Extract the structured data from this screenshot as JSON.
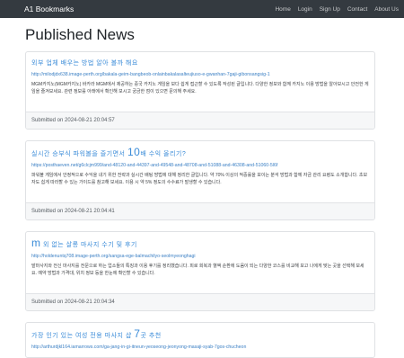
{
  "navbar": {
    "brand": "A1 Bookmarks",
    "links": [
      "Home",
      "Login",
      "Sign Up",
      "Contact",
      "About Us"
    ]
  },
  "page": {
    "title": "Published News"
  },
  "posts": [
    {
      "title_lead": "",
      "title": "외부 업체 배우는 방법 알아 볼까 해요",
      "title_big": "",
      "title_tail": "",
      "url": "http://milodjdx638.image-perth.org/bakala-geim-bangbeob-onlainbakalasalteujiuso-e-gwanhan-7gaji-gibonsangsig-1",
      "text": "MGM카지노(MGM카지노) 바카라 MGM에서 제공하는 중국 카지노 게임을 보다 쉽게 접근할 수 있도록 작성된 글입니다. 다양한 정보와 함께 카지노 이용 방법을 알아보시고 안전한 게임을 즐겨보세요. 관련 정보를 아래에서 확인해 보시고 궁금한 점이 있으면 문의해 주세요.",
      "submitted": "Submitted on 2024-08-21 20:04:57"
    },
    {
      "title_lead": "",
      "title": "실시간 승부식 파워볼을 즐기면서",
      "title_big": "10",
      "title_tail": "배 수익 올리기?",
      "url": "https://posthaeven.net/g6clcjm999/and-48120-and-44397-and-49548-and-48708-and-51088-and-46308-and-51060-5l6f",
      "text": "파워볼 게임에서 안정적으로 수익을 내기 위한 전략과 실시간 배팅 방법에 대해 정리한 글입니다. 약 70% 이상의 적중률을 보이는 분석 방법과 함께 자금 관리 요령도 소개합니다. 초보자도 쉽게 따라할 수 있는 가이드를 참고해 보세요. 이용 시 약 5% 정도의 수수료가 발생할 수 있습니다.",
      "submitted": "Submitted on 2024-08-21 20:04:41"
    },
    {
      "title_lead": "m",
      "title": "외 없는 살롱 마사지 수기 및 후기",
      "title_big": "",
      "title_tail": "",
      "url": "http://holdenuntq708.image-perth.org/sangsa-ege-balmachilyo-seolmyeonghagi",
      "text": "발마사지와 전신 마사지를 전문으로 하는 업소들의 특징과 이용 후기를 정리했습니다. 피로 회복과 혈액 순환에 도움이 되는 다양한 코스를 비교해 보고 나에게 맞는 곳을 선택해 보세요. 예약 방법과 가격대, 위치 정보 등을 한눈에 확인할 수 있습니다.",
      "submitted": "Submitted on 2024-08-21 20:04:34"
    },
    {
      "title_lead": "",
      "title": "가장 인기 있는 여성 전용 마사지 샵",
      "title_big": "7",
      "title_tail": "곳 추천",
      "url": "http://arthurdjkl164.iamarrows.com/ga-jang-in-gi-itneun-yeoseong-jeonyong-masaji-syab-7gos-chucheon",
      "text": "",
      "submitted": ""
    }
  ]
}
